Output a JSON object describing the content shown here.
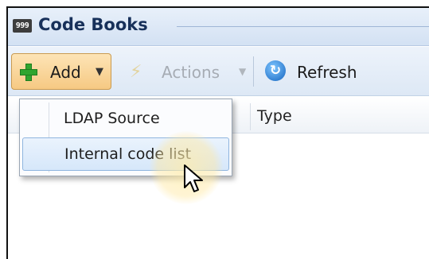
{
  "window": {
    "title": "Code Books",
    "icon": "999"
  },
  "toolbar": {
    "add_label": "Add",
    "actions_label": "Actions",
    "refresh_label": "Refresh"
  },
  "grid": {
    "columns": [
      "",
      "Type"
    ]
  },
  "add_menu": {
    "items": [
      "LDAP Source",
      "Internal code list"
    ],
    "highlighted": "Internal code list"
  },
  "colors": {
    "accent": "#f6c983",
    "title": "#17305a",
    "highlight": "#d6e7fa"
  }
}
